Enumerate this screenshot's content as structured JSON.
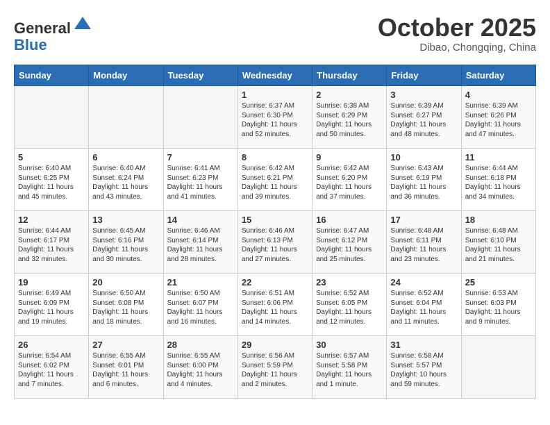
{
  "header": {
    "logo_general": "General",
    "logo_blue": "Blue",
    "month": "October 2025",
    "location": "Dibao, Chongqing, China"
  },
  "weekdays": [
    "Sunday",
    "Monday",
    "Tuesday",
    "Wednesday",
    "Thursday",
    "Friday",
    "Saturday"
  ],
  "weeks": [
    [
      {
        "day": "",
        "content": ""
      },
      {
        "day": "",
        "content": ""
      },
      {
        "day": "",
        "content": ""
      },
      {
        "day": "1",
        "content": "Sunrise: 6:37 AM\nSunset: 6:30 PM\nDaylight: 11 hours and 52 minutes."
      },
      {
        "day": "2",
        "content": "Sunrise: 6:38 AM\nSunset: 6:29 PM\nDaylight: 11 hours and 50 minutes."
      },
      {
        "day": "3",
        "content": "Sunrise: 6:39 AM\nSunset: 6:27 PM\nDaylight: 11 hours and 48 minutes."
      },
      {
        "day": "4",
        "content": "Sunrise: 6:39 AM\nSunset: 6:26 PM\nDaylight: 11 hours and 47 minutes."
      }
    ],
    [
      {
        "day": "5",
        "content": "Sunrise: 6:40 AM\nSunset: 6:25 PM\nDaylight: 11 hours and 45 minutes."
      },
      {
        "day": "6",
        "content": "Sunrise: 6:40 AM\nSunset: 6:24 PM\nDaylight: 11 hours and 43 minutes."
      },
      {
        "day": "7",
        "content": "Sunrise: 6:41 AM\nSunset: 6:23 PM\nDaylight: 11 hours and 41 minutes."
      },
      {
        "day": "8",
        "content": "Sunrise: 6:42 AM\nSunset: 6:21 PM\nDaylight: 11 hours and 39 minutes."
      },
      {
        "day": "9",
        "content": "Sunrise: 6:42 AM\nSunset: 6:20 PM\nDaylight: 11 hours and 37 minutes."
      },
      {
        "day": "10",
        "content": "Sunrise: 6:43 AM\nSunset: 6:19 PM\nDaylight: 11 hours and 36 minutes."
      },
      {
        "day": "11",
        "content": "Sunrise: 6:44 AM\nSunset: 6:18 PM\nDaylight: 11 hours and 34 minutes."
      }
    ],
    [
      {
        "day": "12",
        "content": "Sunrise: 6:44 AM\nSunset: 6:17 PM\nDaylight: 11 hours and 32 minutes."
      },
      {
        "day": "13",
        "content": "Sunrise: 6:45 AM\nSunset: 6:16 PM\nDaylight: 11 hours and 30 minutes."
      },
      {
        "day": "14",
        "content": "Sunrise: 6:46 AM\nSunset: 6:14 PM\nDaylight: 11 hours and 28 minutes."
      },
      {
        "day": "15",
        "content": "Sunrise: 6:46 AM\nSunset: 6:13 PM\nDaylight: 11 hours and 27 minutes."
      },
      {
        "day": "16",
        "content": "Sunrise: 6:47 AM\nSunset: 6:12 PM\nDaylight: 11 hours and 25 minutes."
      },
      {
        "day": "17",
        "content": "Sunrise: 6:48 AM\nSunset: 6:11 PM\nDaylight: 11 hours and 23 minutes."
      },
      {
        "day": "18",
        "content": "Sunrise: 6:48 AM\nSunset: 6:10 PM\nDaylight: 11 hours and 21 minutes."
      }
    ],
    [
      {
        "day": "19",
        "content": "Sunrise: 6:49 AM\nSunset: 6:09 PM\nDaylight: 11 hours and 19 minutes."
      },
      {
        "day": "20",
        "content": "Sunrise: 6:50 AM\nSunset: 6:08 PM\nDaylight: 11 hours and 18 minutes."
      },
      {
        "day": "21",
        "content": "Sunrise: 6:50 AM\nSunset: 6:07 PM\nDaylight: 11 hours and 16 minutes."
      },
      {
        "day": "22",
        "content": "Sunrise: 6:51 AM\nSunset: 6:06 PM\nDaylight: 11 hours and 14 minutes."
      },
      {
        "day": "23",
        "content": "Sunrise: 6:52 AM\nSunset: 6:05 PM\nDaylight: 11 hours and 12 minutes."
      },
      {
        "day": "24",
        "content": "Sunrise: 6:52 AM\nSunset: 6:04 PM\nDaylight: 11 hours and 11 minutes."
      },
      {
        "day": "25",
        "content": "Sunrise: 6:53 AM\nSunset: 6:03 PM\nDaylight: 11 hours and 9 minutes."
      }
    ],
    [
      {
        "day": "26",
        "content": "Sunrise: 6:54 AM\nSunset: 6:02 PM\nDaylight: 11 hours and 7 minutes."
      },
      {
        "day": "27",
        "content": "Sunrise: 6:55 AM\nSunset: 6:01 PM\nDaylight: 11 hours and 6 minutes."
      },
      {
        "day": "28",
        "content": "Sunrise: 6:55 AM\nSunset: 6:00 PM\nDaylight: 11 hours and 4 minutes."
      },
      {
        "day": "29",
        "content": "Sunrise: 6:56 AM\nSunset: 5:59 PM\nDaylight: 11 hours and 2 minutes."
      },
      {
        "day": "30",
        "content": "Sunrise: 6:57 AM\nSunset: 5:58 PM\nDaylight: 11 hours and 1 minute."
      },
      {
        "day": "31",
        "content": "Sunrise: 6:58 AM\nSunset: 5:57 PM\nDaylight: 10 hours and 59 minutes."
      },
      {
        "day": "",
        "content": ""
      }
    ]
  ]
}
